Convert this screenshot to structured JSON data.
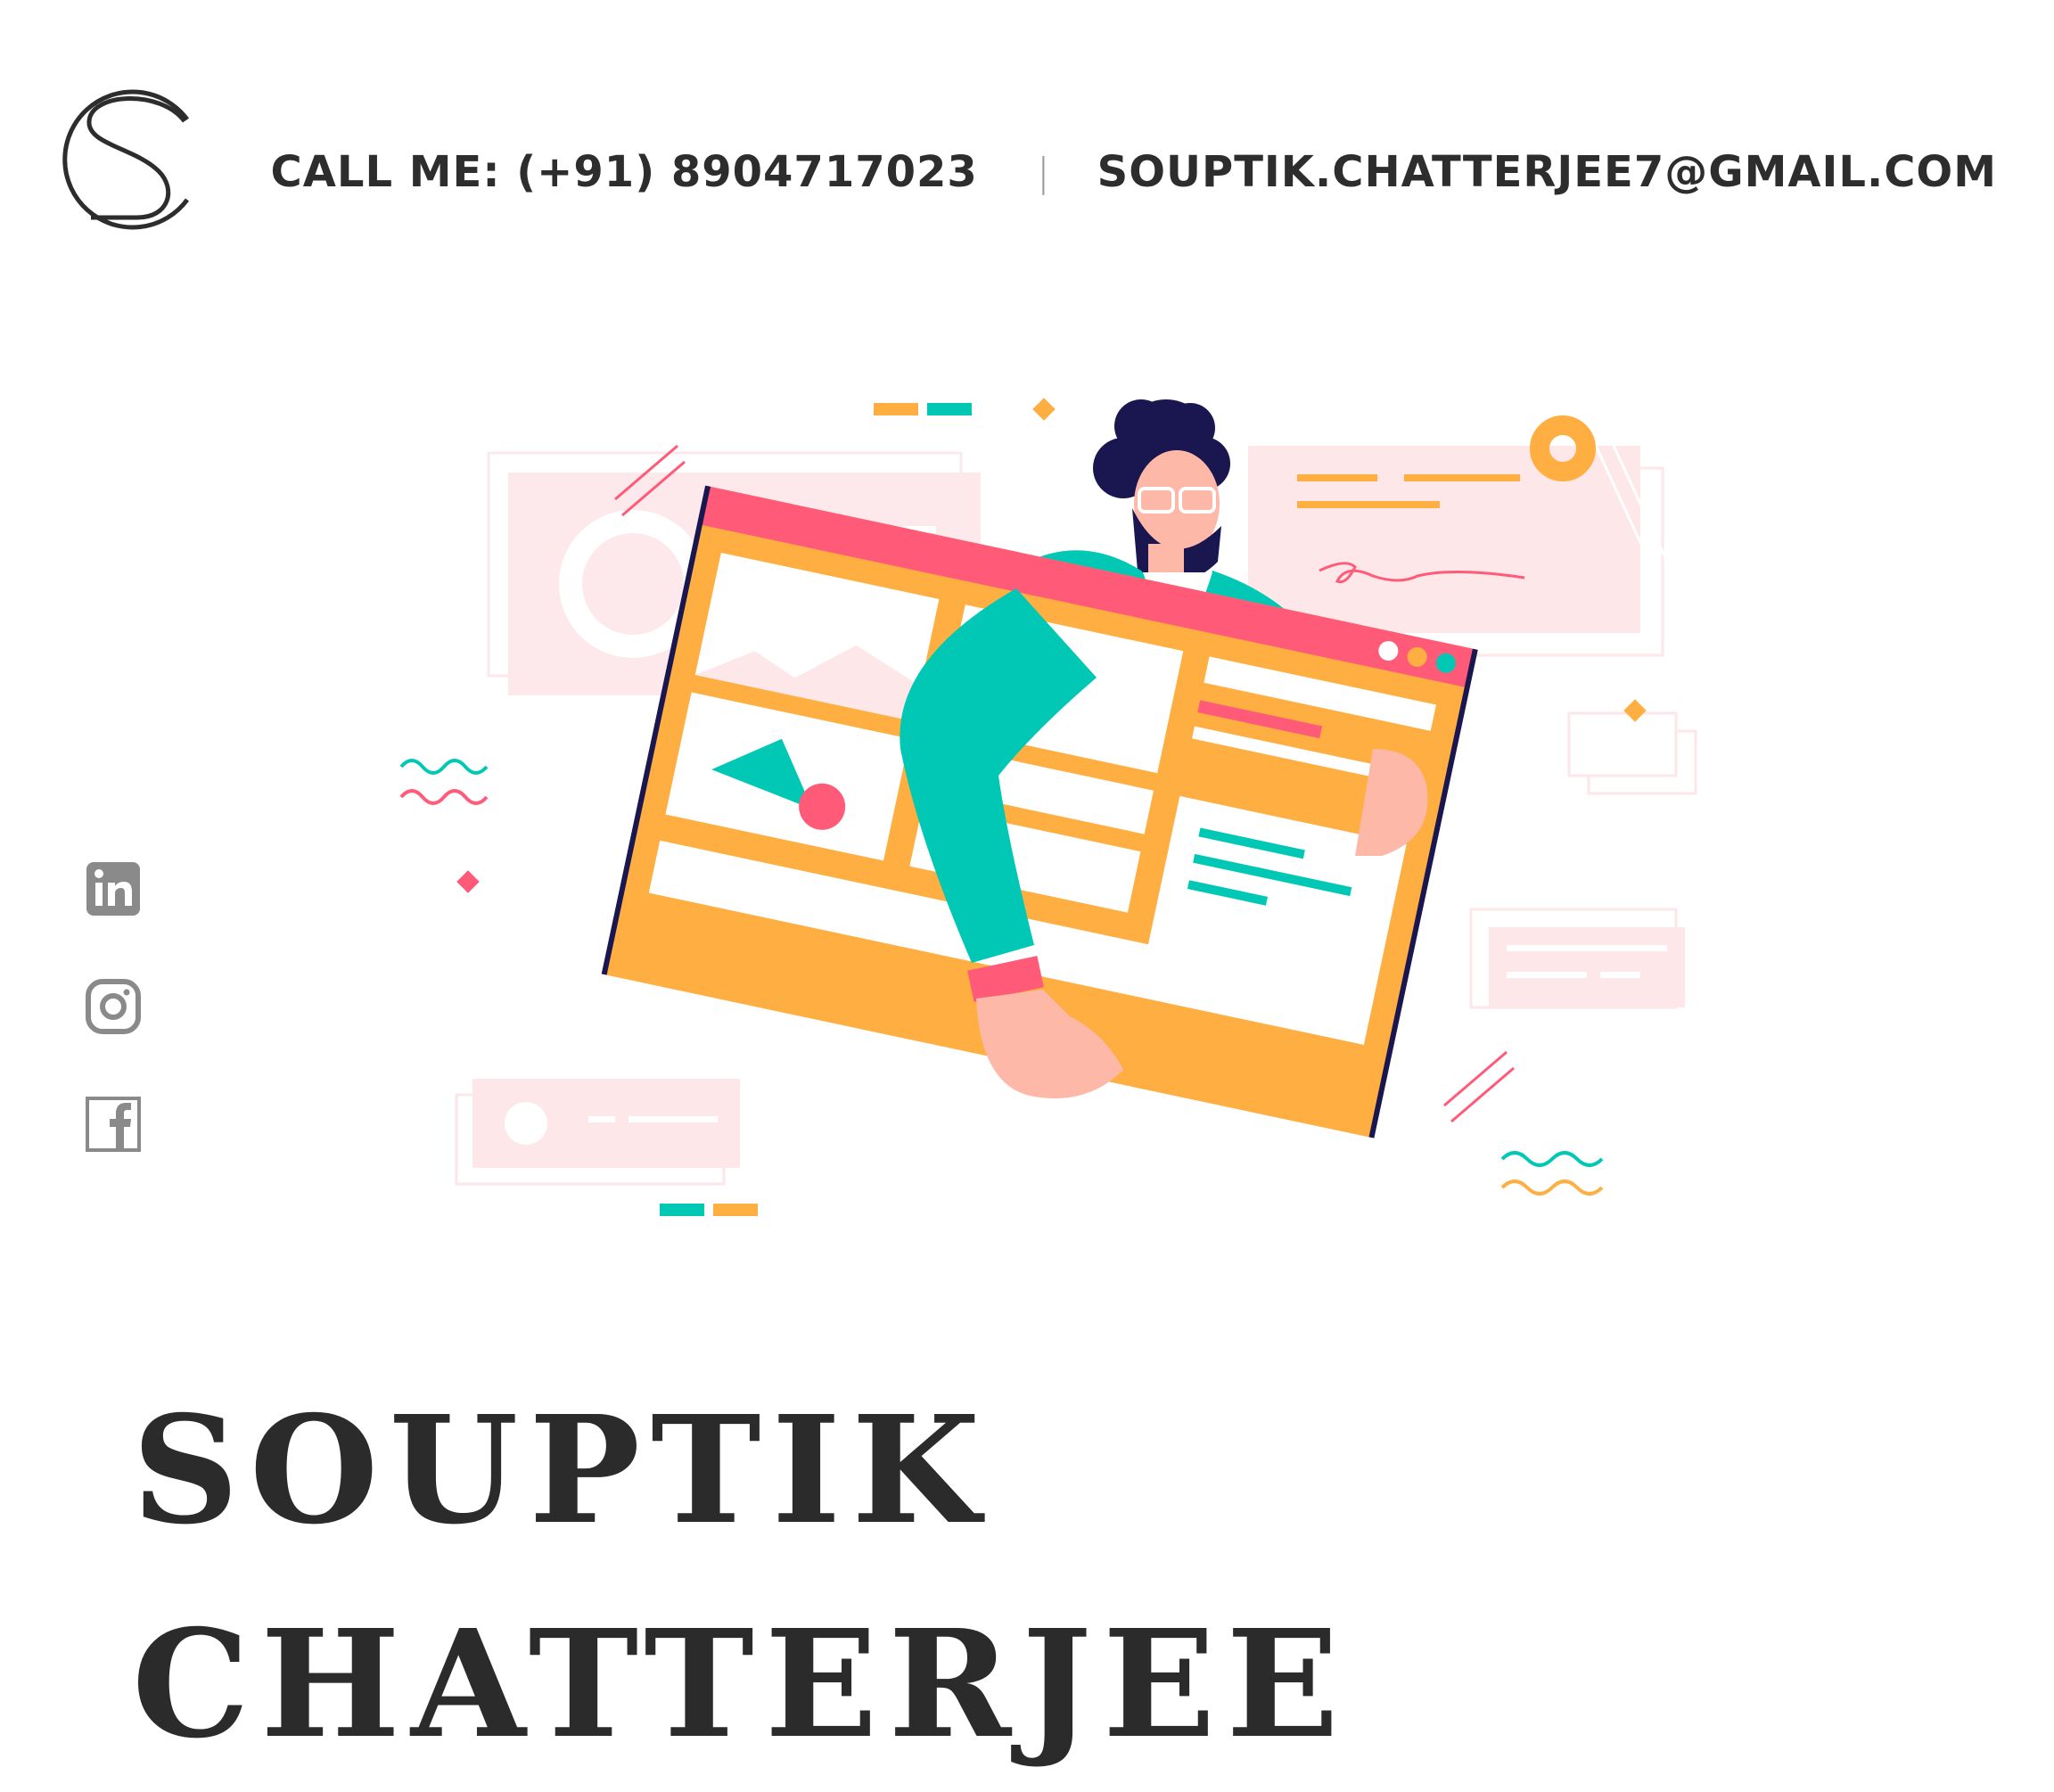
{
  "header": {
    "logo_icon": "s-monogram-logo",
    "call_me_text": "CALL ME: (+91) 8904717023",
    "separator": "|",
    "email_text": "SOUPTIK.CHATTERJEE7@GMAIL.COM"
  },
  "social": {
    "items": [
      {
        "icon": "linkedin-icon"
      },
      {
        "icon": "instagram-icon"
      },
      {
        "icon": "facebook-icon"
      }
    ],
    "icon_color": "#8a8a8a"
  },
  "hero": {
    "illustration": "man-carrying-browser-window-illustration",
    "first_name": "SOUPTIK",
    "last_name": "CHATTERJEE"
  },
  "colors": {
    "text": "#2b2b2b",
    "accent_teal": "#00c8b4",
    "accent_orange": "#ffae42",
    "accent_pink": "#ff5a78",
    "dark_navy": "#1a1650"
  }
}
